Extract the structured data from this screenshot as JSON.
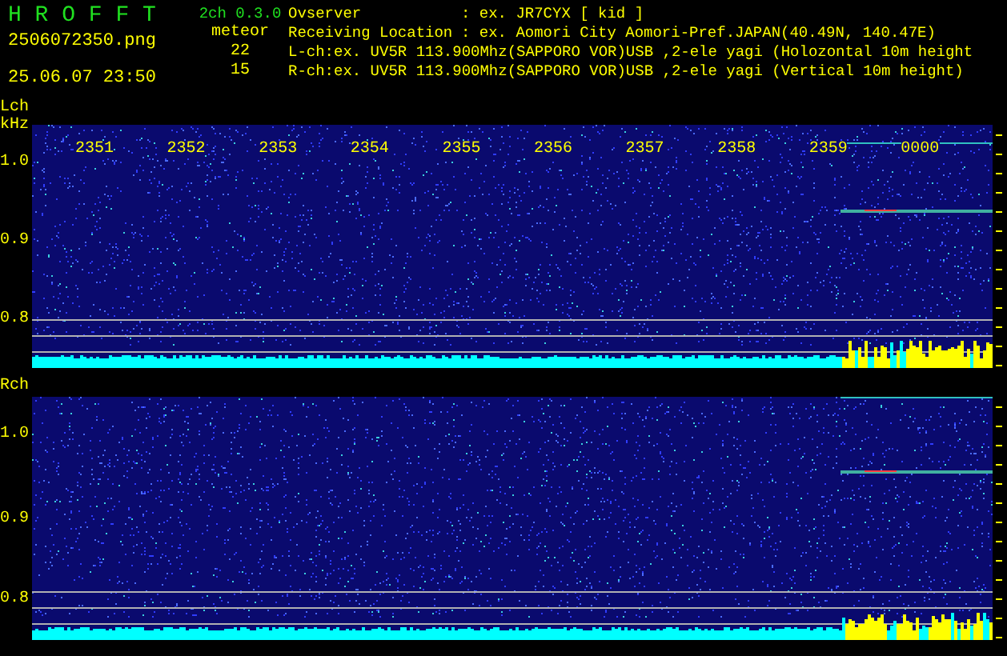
{
  "app": {
    "title": "H R O F F T",
    "version": "2ch 0.3.0"
  },
  "file_name": "2506072350.png",
  "date_time": "25.06.07 23:50",
  "meteor": {
    "label": "meteor",
    "lch_count": "22",
    "rch_count": "15"
  },
  "info": [
    {
      "label": "Ovserver",
      "value": ": ex. JR7CYX [ kid ]"
    },
    {
      "label": "Receiving Location",
      "value": ": ex. Aomori City Aomori-Pref.JAPAN(40.49N, 140.47E)"
    }
  ],
  "channel_lines": [
    "L-ch:ex. UV5R 113.900Mhz(SAPPORO VOR)USB ,2-ele yagi (Holozontal 10m height",
    "R-ch:ex. UV5R 113.900Mhz(SAPPORO VOR)USB ,2-ele yagi (Vertical 10m height)"
  ],
  "panels": [
    {
      "label": "Lch",
      "unit": "kHz",
      "time_labels": [
        "2351",
        "2352",
        "2353",
        "2354",
        "2355",
        "2356",
        "2357",
        "2358",
        "2359",
        "0000"
      ],
      "y_labels": [
        "1.0",
        "0.9",
        "0.8"
      ]
    },
    {
      "label": "Rch",
      "y_labels": [
        "1.0",
        "0.9",
        "0.8"
      ]
    }
  ]
}
